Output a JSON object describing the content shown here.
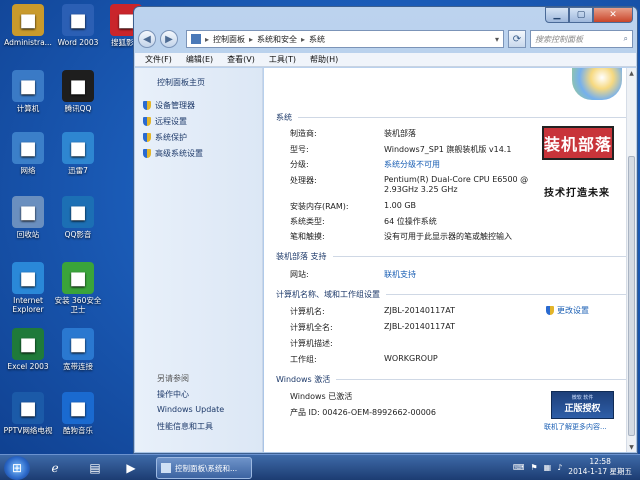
{
  "desktop_icons": [
    {
      "label": "Administra...",
      "icon": "user-folder-icon",
      "color": "#c99a2c"
    },
    {
      "label": "Word 2003",
      "icon": "word-icon",
      "color": "#2b5fb4"
    },
    {
      "label": "搜狐影音",
      "icon": "sohu-video-icon",
      "color": "#c9252b"
    },
    {
      "label": "计算机",
      "icon": "computer-icon",
      "color": "#3a7ac6"
    },
    {
      "label": "腾讯QQ",
      "icon": "qq-icon",
      "color": "#1e1e1e"
    },
    {
      "label": "网络",
      "icon": "network-icon",
      "color": "#3b7fc9"
    },
    {
      "label": "迅雷7",
      "icon": "thunder-icon",
      "color": "#2e86d1"
    },
    {
      "label": "回收站",
      "icon": "recycle-bin-icon",
      "color": "#6a8fbf"
    },
    {
      "label": "QQ影音",
      "icon": "qq-player-icon",
      "color": "#1c6fb4"
    },
    {
      "label": "Internet Explorer",
      "icon": "ie-icon",
      "color": "#2a88d8"
    },
    {
      "label": "安装 360安全卫士",
      "icon": "360-safe-icon",
      "color": "#3aa43a"
    },
    {
      "label": "Excel 2003",
      "icon": "excel-icon",
      "color": "#1f7a3a"
    },
    {
      "label": "宽带连接",
      "icon": "broadband-icon",
      "color": "#2a78d0"
    },
    {
      "label": "PPTV网络电视",
      "icon": "pptv-icon",
      "color": "#1b5aa8"
    },
    {
      "label": "酷狗音乐",
      "icon": "kugou-icon",
      "color": "#1a6ad0"
    }
  ],
  "window": {
    "breadcrumb": [
      "控制面板",
      "系统和安全",
      "系统"
    ],
    "search_placeholder": "搜索控制面板",
    "menu": [
      "文件(F)",
      "编辑(E)",
      "查看(V)",
      "工具(T)",
      "帮助(H)"
    ],
    "sidebar": {
      "home": "控制面板主页",
      "links": [
        "设备管理器",
        "远程设置",
        "系统保护",
        "高级系统设置"
      ],
      "see_also_title": "另请参阅",
      "see_also": [
        "操作中心",
        "Windows Update",
        "性能信息和工具"
      ]
    },
    "system": {
      "section": "系统",
      "rows": [
        {
          "label": "制造商:",
          "value": "装机部落"
        },
        {
          "label": "型号:",
          "value": "Windows7_SP1 旗舰装机版 v14.1"
        },
        {
          "label": "分级:",
          "value": "系统分级不可用"
        },
        {
          "label": "处理器:",
          "value": "Pentium(R) Dual-Core  CPU      E6500  @",
          "value2": "2.93GHz   3.25 GHz"
        },
        {
          "label": "安装内存(RAM):",
          "value": "1.00 GB"
        },
        {
          "label": "系统类型:",
          "value": "64 位操作系统"
        },
        {
          "label": "笔和触摸:",
          "value": "没有可用于此显示器的笔或触控输入"
        }
      ]
    },
    "support": {
      "section": "装机部落 支持",
      "label": "网站:",
      "value": "联机支持"
    },
    "computer": {
      "section": "计算机名称、域和工作组设置",
      "rows": [
        {
          "label": "计算机名:",
          "value": "ZJBL-20140117AT"
        },
        {
          "label": "计算机全名:",
          "value": "ZJBL-20140117AT"
        },
        {
          "label": "计算机描述:",
          "value": ""
        },
        {
          "label": "工作组:",
          "value": "WORKGROUP"
        }
      ],
      "change_settings": "更改设置"
    },
    "activation": {
      "section": "Windows 激活",
      "status": "Windows 已激活",
      "product_id": "产品 ID: 00426-OEM-8992662-00006",
      "learn_more": "联机了解更多内容...",
      "genuine_top": "微软 软件",
      "genuine_main": "正版授权"
    },
    "branding": {
      "logo_text": "装机部落",
      "slogan": "技术打造未来"
    }
  },
  "taskbar": {
    "task_label": "控制面板\\系统和...",
    "time": "12:58",
    "date": "2014-1-17 星期五"
  }
}
